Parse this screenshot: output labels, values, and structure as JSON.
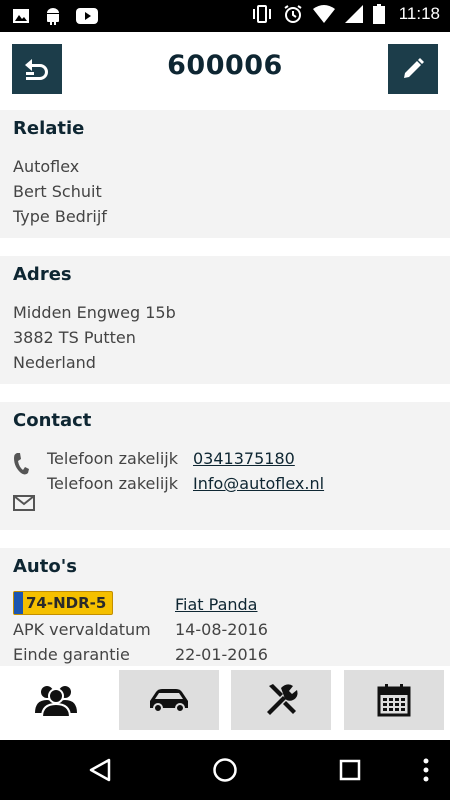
{
  "status_bar": {
    "time": "11:18",
    "icons": [
      "image-icon",
      "android-icon",
      "youtube-icon",
      "vibrate-icon",
      "alarm-icon",
      "wifi-icon",
      "signal-icon",
      "battery-icon"
    ]
  },
  "header": {
    "title": "600006",
    "back_icon": "back-undo-icon",
    "edit_icon": "pencil-icon",
    "accent": "#1c3d4a"
  },
  "relatie": {
    "heading": "Relatie",
    "lines": [
      "Autoflex",
      "Bert Schuit",
      "Type Bedrijf"
    ]
  },
  "adres": {
    "heading": "Adres",
    "lines": [
      "Midden Engweg 15b",
      "3882 TS Putten",
      "Nederland"
    ]
  },
  "contact": {
    "heading": "Contact",
    "rows": [
      {
        "label": "Telefoon zakelijk",
        "value": "0341375180"
      },
      {
        "label": "Telefoon zakelijk",
        "value": "Info@autoflex.nl"
      }
    ],
    "icons": [
      "phone-icon",
      "mail-icon"
    ]
  },
  "autos": {
    "heading": "Auto's",
    "plate": "74-NDR-5",
    "model": "Fiat Panda",
    "rows": [
      {
        "label": "APK vervaldatum",
        "value": "14-08-2016"
      },
      {
        "label": "Einde garantie",
        "value": "22-01-2016"
      }
    ]
  },
  "bottom_nav": {
    "items": [
      "relations-icon",
      "car-icon",
      "tools-icon",
      "calendar-icon"
    ],
    "active": 0
  },
  "system_nav": {
    "items": [
      "back-triangle-icon",
      "home-circle-icon",
      "recents-square-icon",
      "more-dots-icon"
    ]
  }
}
